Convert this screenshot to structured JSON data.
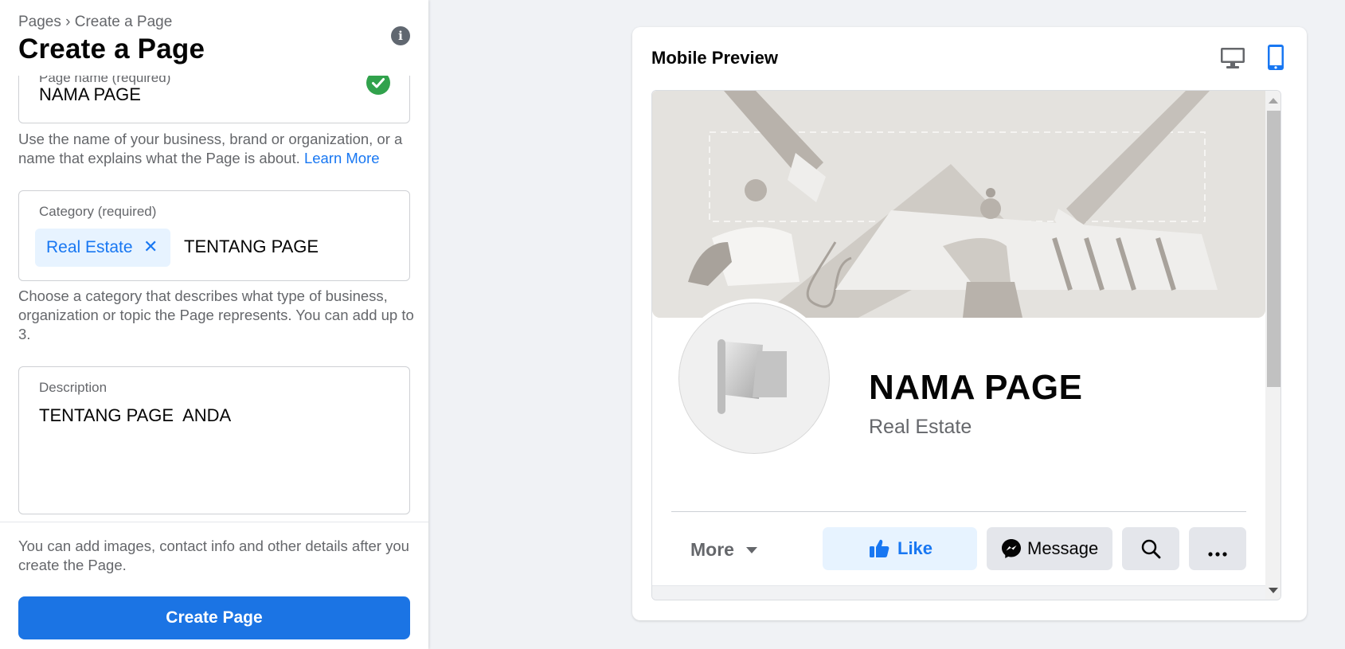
{
  "colors": {
    "accent": "#1877f2",
    "create_button": "#1b74e4",
    "check": "#31a24c",
    "chip_bg": "#e7f3ff"
  },
  "left_panel": {
    "breadcrumb": "Pages › Create a Page",
    "title": "Create a Page",
    "info_icon": "info-icon",
    "page_name": {
      "label": "Page name (required)",
      "value": "NAMA PAGE",
      "status_icon": "check-circle-icon"
    },
    "page_name_help": "Use the name of your business, brand or organization, or a name that explains what the Page is about.",
    "learn_more": "Learn More",
    "category": {
      "label": "Category (required)",
      "chip_label": "Real Estate",
      "chip_remove_icon": "close-icon",
      "input_value": "TENTANG PAGE"
    },
    "category_help": "Choose a category that describes what type of business, organization or topic the Page represents. You can add up to 3.",
    "description": {
      "label": "Description",
      "value": "TENTANG PAGE  ANDA"
    },
    "footer_note": "You can add images, contact info and other details after you create the Page.",
    "create_button": "Create Page"
  },
  "preview": {
    "title": "Mobile Preview",
    "device_icons": [
      "desktop-icon",
      "mobile-icon"
    ],
    "selected_device": "mobile",
    "page_name": "NAMA PAGE",
    "category": "Real Estate",
    "more_label": "More",
    "like_label": "Like",
    "message_label": "Message",
    "action_icons": [
      "thumbs-up-icon",
      "messenger-icon",
      "search-icon",
      "more-dots-icon"
    ]
  }
}
